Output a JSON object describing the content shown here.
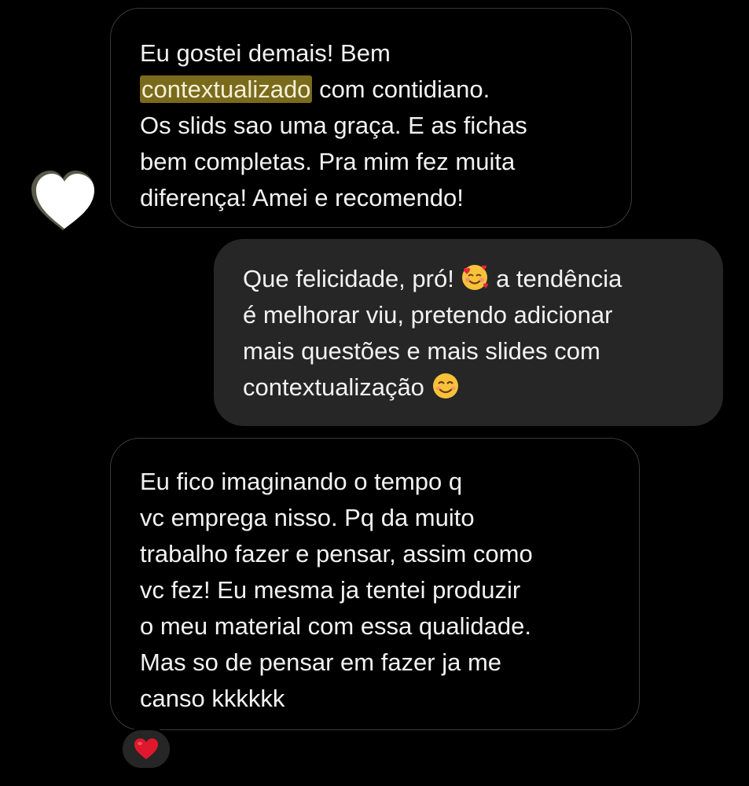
{
  "messages": [
    {
      "direction": "received",
      "lines": [
        "Eu gostei demais! Bem",
        "contextualizado",
        "com contidiano.",
        "Os slids sao uma graça. E as fichas",
        "bem completas. Pra mim fez muita",
        "diferença! Amei e recomendo!"
      ],
      "highlight_color": "#7a6a1c"
    },
    {
      "direction": "sent",
      "lines": [
        "Que felicidade, pró!",
        "a tendência",
        "é melhorar viu, pretendo adicionar",
        "mais questões e mais slides com",
        "contextualização"
      ],
      "emojis": [
        "smiling-face-with-hearts",
        "smiling-face-with-smiling-eyes"
      ]
    },
    {
      "direction": "received",
      "lines": [
        "Eu fico imaginando o tempo q",
        "vc emprega nisso. Pq da muito",
        "trabalho fazer e pensar, assim como",
        "vc fez! Eu mesma ja tentei produzir",
        "o meu material com essa qualidade.",
        "Mas so de pensar em fazer ja me",
        "canso kkkkkk"
      ],
      "reaction": "red-heart"
    }
  ],
  "colors": {
    "background": "#000000",
    "sent_bubble": "#262626",
    "received_border": "#3a3a3a",
    "text": "#f2f2f2",
    "reaction": "#e0182d"
  }
}
